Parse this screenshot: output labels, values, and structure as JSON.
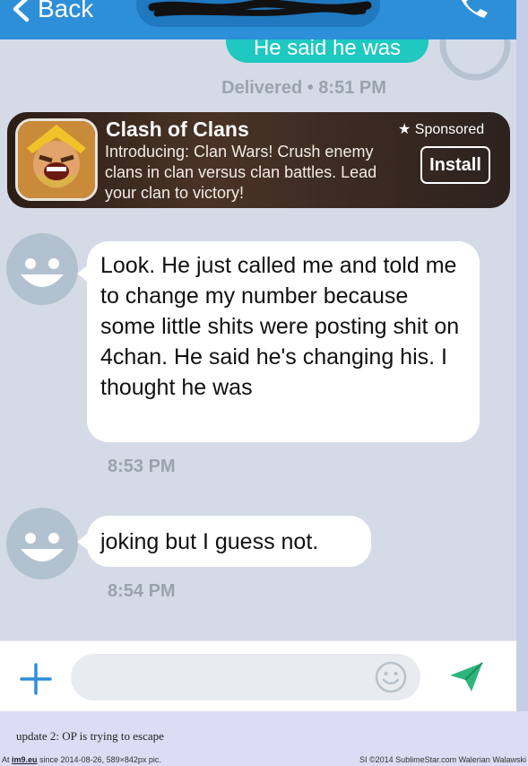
{
  "header": {
    "back_label": "Back"
  },
  "messages": {
    "sent_partial": "He said he was",
    "delivered": "Delivered • 8:51 PM",
    "received": [
      {
        "text": "Look. He just called me and told me to change my number because some little shits were posting shit on 4chan. He said he's changing his. I thought he was",
        "time": "8:53 PM"
      },
      {
        "text": "joking but I guess not.",
        "time": "8:54 PM"
      }
    ]
  },
  "ad": {
    "title": "Clash of Clans",
    "description": "Introducing: Clan Wars! Crush enemy clans in clan versus clan battles. Lead your clan to victory!",
    "sponsored": "★ Sponsored",
    "install": "Install"
  },
  "composer": {
    "placeholder": ""
  },
  "caption": "update 2: OP is trying to escape",
  "footer": {
    "at": "At ",
    "site": "im9.eu",
    "left": " since 2014-08-26, 589×842px pic.",
    "right": "SI ©2014 SublimeStar.com Walerian Walawski"
  },
  "colors": {
    "header_blue": "#2d8fd8",
    "sent_bubble": "#1fc8c0",
    "send_green": "#2db67c",
    "chat_bg": "#d5dbe6"
  },
  "icons": [
    "chevron-left-icon",
    "phone-icon",
    "avatar-icon",
    "plus-icon",
    "smiley-icon",
    "send-icon",
    "clash-of-clans-icon"
  ]
}
